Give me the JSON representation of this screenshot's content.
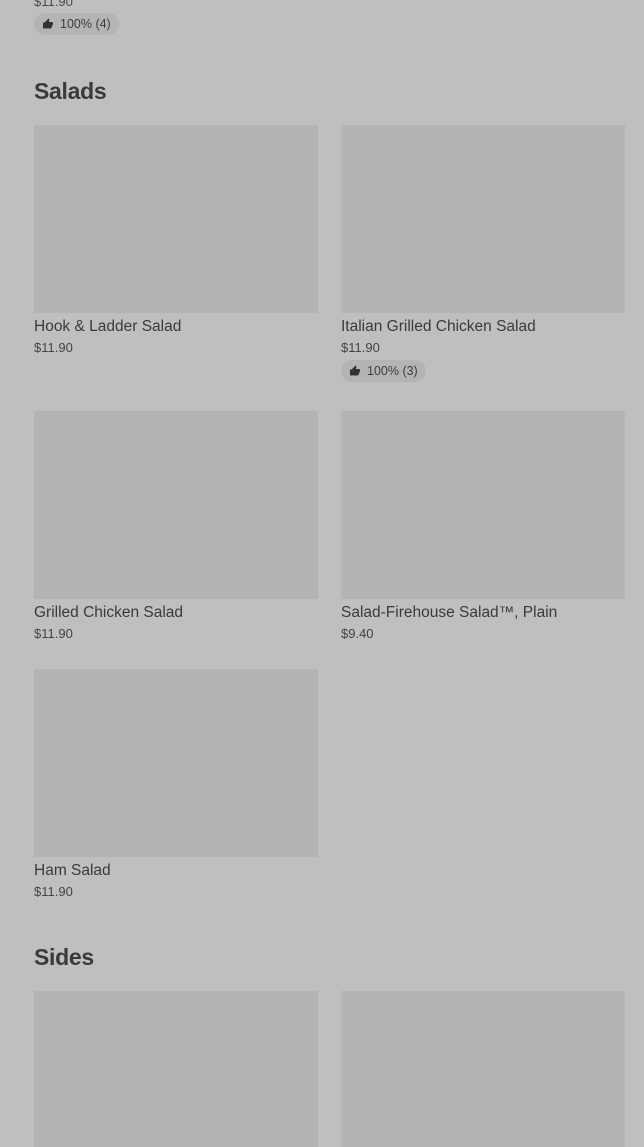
{
  "top_item": {
    "price": "$11.90",
    "rating": "100% (4)"
  },
  "sections": {
    "salads": {
      "title": "Salads",
      "items": [
        {
          "name": "Hook & Ladder Salad",
          "price": "$11.90"
        },
        {
          "name": "Italian Grilled Chicken Salad",
          "price": "$11.90",
          "rating": "100% (3)"
        },
        {
          "name": "Grilled Chicken Salad",
          "price": "$11.90"
        },
        {
          "name": "Salad-Firehouse Salad™, Plain",
          "price": "$9.40"
        },
        {
          "name": "Ham Salad",
          "price": "$11.90"
        }
      ]
    },
    "sides": {
      "title": "Sides"
    }
  },
  "icons": {
    "rating": "thumbs-up-icon"
  },
  "colors": {
    "background": "#bfbfbf",
    "image_placeholder": "#b4b4b4",
    "text": "#3a3a3a"
  }
}
